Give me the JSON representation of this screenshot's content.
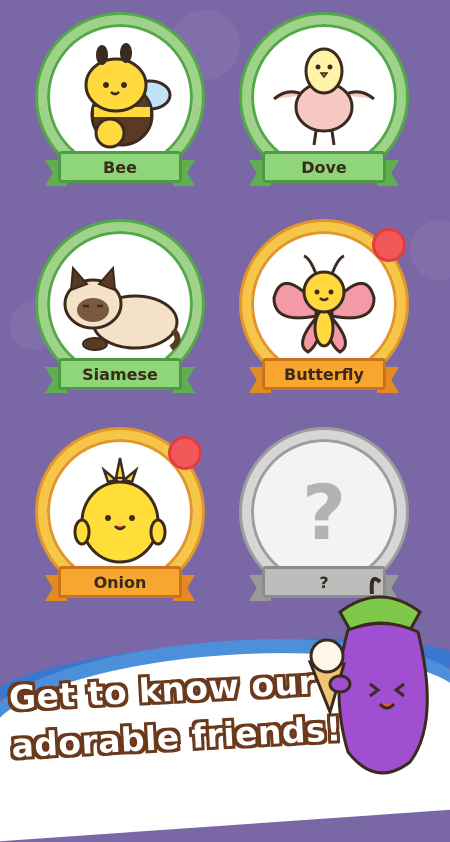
{
  "friends": [
    {
      "name": "Bee",
      "style": "green",
      "new": false,
      "icon": "bee-icon"
    },
    {
      "name": "Dove",
      "style": "green",
      "new": false,
      "icon": "dove-icon"
    },
    {
      "name": "Siamese",
      "style": "green",
      "new": false,
      "icon": "siamese-cat-icon"
    },
    {
      "name": "Butterfly",
      "style": "gold",
      "new": true,
      "icon": "butterfly-icon"
    },
    {
      "name": "Onion",
      "style": "gold",
      "new": true,
      "icon": "onion-icon"
    },
    {
      "name": "?",
      "style": "gray",
      "new": false,
      "icon": "question-mark-icon",
      "locked_symbol": "?"
    }
  ],
  "banner": {
    "line1": "Get to know our",
    "line2": "adorable friends!"
  },
  "colors": {
    "background": "#7a68a6",
    "green_ribbon": "#8fd57a",
    "gold_ribbon": "#f7a630",
    "gray_ribbon": "#bdbdbd",
    "new_dot": "#f2575a",
    "banner_blue": "#3a78d0"
  }
}
